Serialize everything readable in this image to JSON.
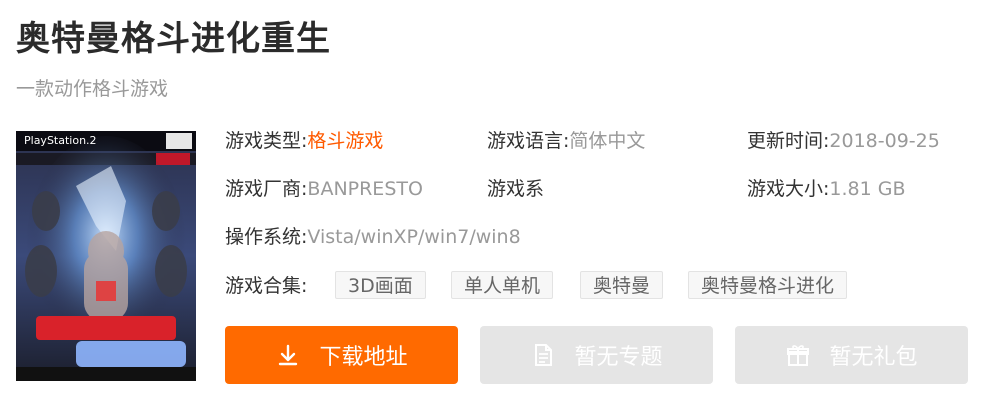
{
  "game": {
    "title": "奥特曼格斗进化重生",
    "subtitle": "一款动作格斗游戏",
    "cover": {
      "platform_text": "PlayStation.2",
      "alt_icon": "cover-art-image"
    }
  },
  "meta": {
    "type_label": "游戏类型:",
    "type_value": "格斗游戏",
    "language_label": "游戏语言:",
    "language_value": "简体中文",
    "updated_label": "更新时间:",
    "updated_value": "2018-09-25",
    "vendor_label": "游戏厂商:",
    "vendor_value": "BANPRESTO",
    "series_label": "游戏系",
    "size_label": "游戏大小:",
    "size_value": "1.81 GB",
    "os_label": "操作系统:",
    "os_value": "Vista/winXP/win7/win8"
  },
  "collection": {
    "label": "游戏合集:",
    "tags": [
      "3D画面",
      "单人单机",
      "奥特曼",
      "奥特曼格斗进化"
    ]
  },
  "actions": {
    "download_label": "下载地址",
    "topic_label": "暂无专题",
    "gift_label": "暂无礼包",
    "download_icon": "download-icon",
    "topic_icon": "document-icon",
    "gift_icon": "gift-icon"
  },
  "colors": {
    "accent": "#ff6a00",
    "link": "#ff5a00",
    "disabled": "#e5e5e5"
  }
}
